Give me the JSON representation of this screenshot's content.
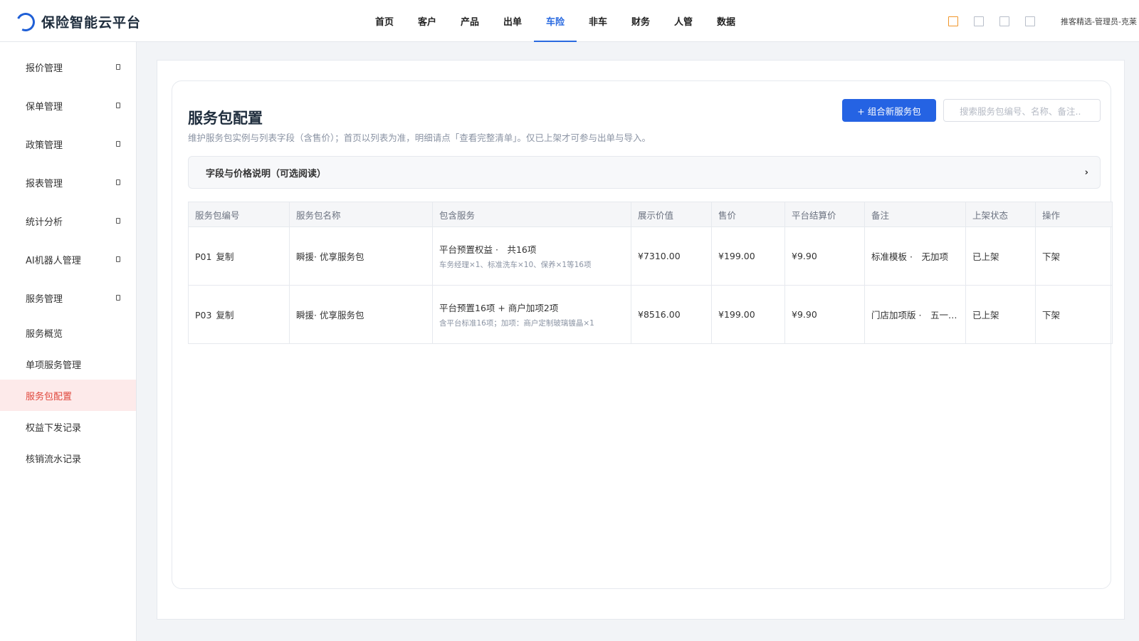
{
  "app": {
    "title": "保险智能云平台"
  },
  "nav": [
    "首页",
    "客户",
    "产品",
    "出单",
    "车险",
    "非车",
    "财务",
    "人管",
    "数据"
  ],
  "nav_active_index": 4,
  "user": {
    "name": "推客精选-管理员-克莱"
  },
  "sidebar": {
    "groups": [
      "报价管理",
      "保单管理",
      "政策管理",
      "报表管理",
      "统计分析",
      "AI机器人管理",
      "服务管理"
    ],
    "subs": [
      "服务概览",
      "单项服务管理",
      "服务包配置",
      "权益下发记录",
      "核销流水记录"
    ],
    "active_sub": "服务包配置"
  },
  "page": {
    "title": "服务包配置",
    "description": "维护服务包实例与列表字段（含售价）；首页以列表为准，明细请点「查看完整清单」。仅已上架才可参与出单与导入。",
    "add_button": "+ 组合新服务包",
    "search_placeholder": "搜索服务包编号、名称、备注..",
    "collapse_label": "字段与价格说明（可选阅读）",
    "collapse_arrow": "›"
  },
  "table": {
    "headers": [
      "服务包编号",
      "服务包名称",
      "包含服务",
      "展示价值",
      "售价",
      "平台结算价",
      "备注",
      "上架状态",
      "操作"
    ],
    "rows": [
      {
        "code": "P01",
        "copy": "复制",
        "name": "瞬援· 优享服务包",
        "services_main": "平台预置权益 ·　共16项",
        "services_sub": "车务经理×1、标准洗车×10、保养×1等16项",
        "display_value": "¥7310.00",
        "price": "¥199.00",
        "settlement": "¥9.90",
        "note": "标准模板 ·　无加项",
        "status": "已上架",
        "action": "下架"
      },
      {
        "code": "P03",
        "copy": "复制",
        "name": "瞬援· 优享服务包",
        "services_main": "平台预置16项 + 商户加项2项",
        "services_sub": "含平台标准16项；加项：商户定制玻璃镀晶×1",
        "display_value": "¥8516.00",
        "price": "¥199.00",
        "settlement": "¥9.90",
        "note": "门店加项版 ·　五一活...",
        "status": "已上架",
        "action": "下架"
      }
    ]
  },
  "colors": {
    "primary": "#2563e3",
    "active_menu_bg": "#fdeaea",
    "active_menu_text": "#e0483d",
    "tool_icon_highlight": "#f0962a"
  }
}
